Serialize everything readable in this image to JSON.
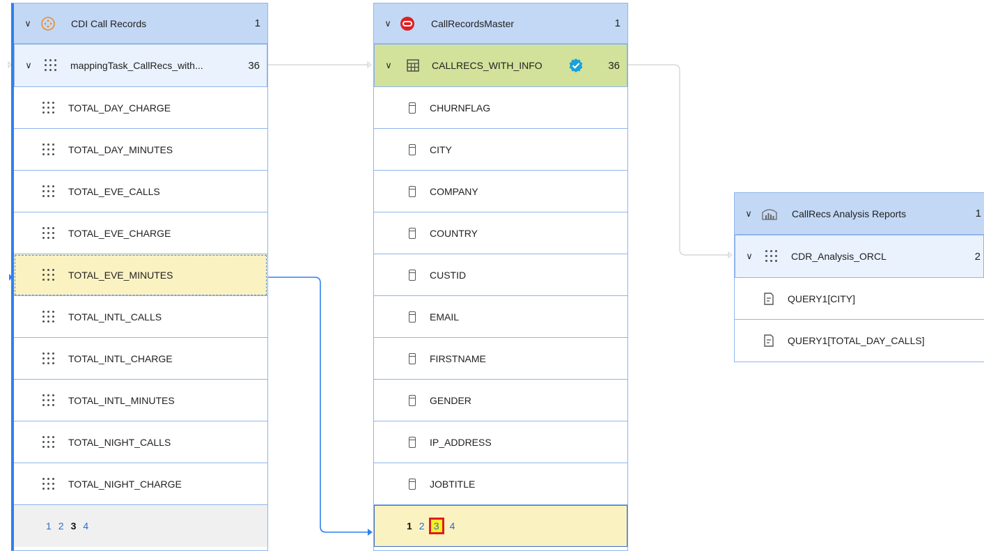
{
  "colors": {
    "accent": "#2f80ed",
    "header_bg": "#c3d8f5",
    "subheader_bg": "#eaf2fd",
    "selected_table_bg": "#d2e29a",
    "highlight_bg": "#fbf2c2",
    "pager_bg_left": "#f0f0f0",
    "highlight_box": "#e01b1b"
  },
  "left": {
    "header": {
      "label": "CDI Call Records",
      "count": "1",
      "icon": "target-icon"
    },
    "subheader": {
      "label": "mappingTask_CallRecs_with...",
      "count": "36",
      "icon": "dots-grid-icon"
    },
    "items": [
      {
        "label": "TOTAL_DAY_CHARGE"
      },
      {
        "label": "TOTAL_DAY_MINUTES"
      },
      {
        "label": "TOTAL_EVE_CALLS"
      },
      {
        "label": "TOTAL_EVE_CHARGE"
      },
      {
        "label": "TOTAL_EVE_MINUTES"
      },
      {
        "label": "TOTAL_INTL_CALLS"
      },
      {
        "label": "TOTAL_INTL_CHARGE"
      },
      {
        "label": "TOTAL_INTL_MINUTES"
      },
      {
        "label": "TOTAL_NIGHT_CALLS"
      },
      {
        "label": "TOTAL_NIGHT_CHARGE"
      }
    ],
    "pager": [
      "1",
      "2",
      "3",
      "4"
    ],
    "pager_current": "3"
  },
  "middle": {
    "header": {
      "label": "CallRecordsMaster",
      "count": "1",
      "icon": "oracle-icon"
    },
    "subheader": {
      "label": "CALLRECS_WITH_INFO",
      "count": "36",
      "icon": "table-icon"
    },
    "items": [
      {
        "label": "CHURNFLAG"
      },
      {
        "label": "CITY"
      },
      {
        "label": "COMPANY"
      },
      {
        "label": "COUNTRY"
      },
      {
        "label": "CUSTID"
      },
      {
        "label": "EMAIL"
      },
      {
        "label": "FIRSTNAME"
      },
      {
        "label": "GENDER"
      },
      {
        "label": "IP_ADDRESS"
      },
      {
        "label": "JOBTITLE"
      }
    ],
    "pager": [
      "1",
      "2",
      "3",
      "4"
    ],
    "pager_current": "1"
  },
  "right": {
    "header": {
      "label": "CallRecs Analysis Reports",
      "count": "1",
      "icon": "report-chart-icon"
    },
    "subheader": {
      "label": "CDR_Analysis_ORCL",
      "count": "2",
      "icon": "dots-grid-icon"
    },
    "items": [
      {
        "label": "QUERY1[CITY]"
      },
      {
        "label": "QUERY1[TOTAL_DAY_CALLS]"
      }
    ]
  }
}
